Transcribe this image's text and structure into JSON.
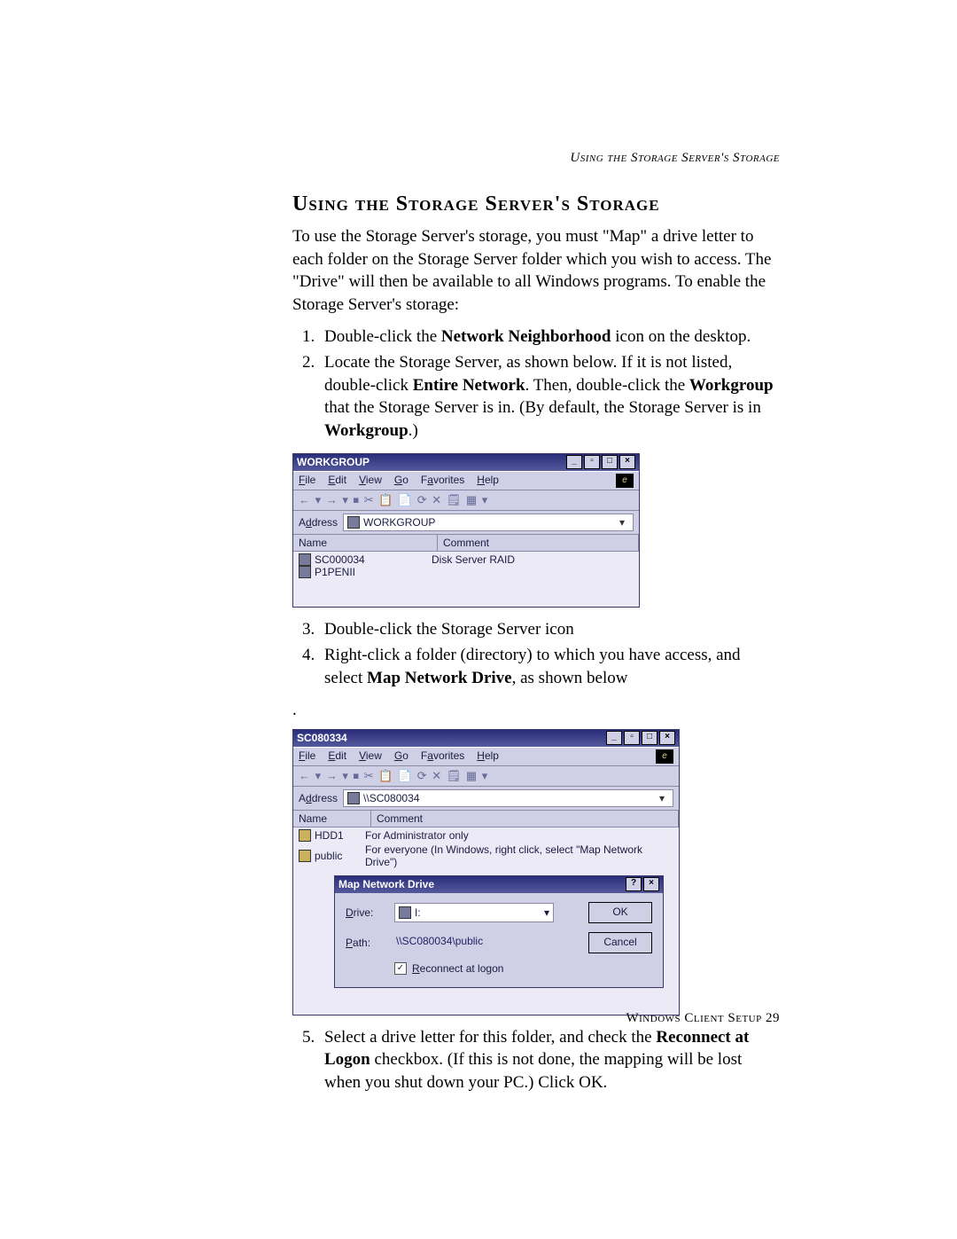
{
  "running_header": "Using the Storage Server's Storage",
  "title": "Using the Storage Server's Storage",
  "intro": "To use the Storage Server's storage, you must \"Map\" a drive letter to each folder on the Storage Server folder which you wish to access. The \"Drive\" will then be available to all Windows programs. To enable the Storage Server's storage:",
  "step1_a": "Double-click the ",
  "step1_b": "Network Neighborhood",
  "step1_c": " icon on the desktop.",
  "step2_a": "Locate the Storage Server, as shown below. If it is not listed, double-click ",
  "step2_b": "Entire Network",
  "step2_c": ". Then, double-click the ",
  "step2_d": "Workgroup",
  "step2_e": " that the Storage Server is in. (By default, the Storage Server is in ",
  "step2_f": "Workgroup",
  "step2_g": ".)",
  "win1": {
    "title": "WORKGROUP",
    "menu": {
      "file": "File",
      "edit": "Edit",
      "view": "View",
      "go": "Go",
      "fav": "Favorites",
      "help": "Help"
    },
    "toolbar_glyphs": "← ▾ → ▾ ⏹  ✂ 📋 📄 ⟳  ✕ 🗒  ▦ ▾",
    "addr_label": "Address",
    "addr_value": "WORKGROUP",
    "col_name": "Name",
    "col_comment": "Comment",
    "rows": [
      {
        "name": "SC000034",
        "comment": "Disk Server RAID"
      },
      {
        "name": "P1PENII",
        "comment": ""
      }
    ]
  },
  "step3": "Double-click the Storage Server icon",
  "step4_a": "Right-click a folder (directory) to which you have access, and select ",
  "step4_b": "Map Network Drive",
  "step4_c": ", as shown below",
  "win2": {
    "title": "SC080334",
    "menu": {
      "file": "File",
      "edit": "Edit",
      "view": "View",
      "go": "Go",
      "fav": "Favorites",
      "help": "Help"
    },
    "toolbar_glyphs": "← ▾ → ▾ ⏹  ✂ 📋 📄 ⟳  ✕ 🗒  ▦ ▾",
    "addr_label": "Address",
    "addr_value": "\\\\SC080034",
    "col_name": "Name",
    "col_comment": "Comment",
    "rows": [
      {
        "name": "HDD1",
        "comment": "For Administrator only"
      },
      {
        "name": "public",
        "comment": "For everyone (In Windows, right click, select \"Map Network Drive\")"
      }
    ],
    "dialog": {
      "title": "Map Network Drive",
      "drive_label": "Drive:",
      "drive_value": "I:",
      "path_label": "Path:",
      "path_value": "\\\\SC080034\\public",
      "ok": "OK",
      "cancel": "Cancel",
      "reconnect": "Reconnect at logon"
    }
  },
  "step5_a": "Select a drive letter for this folder, and check the ",
  "step5_b": "Reconnect at Logon",
  "step5_c": " checkbox. (If this is not done, the mapping will be lost when you shut down your PC.) Click OK.",
  "footer_a": "Windows Client Setup ",
  "footer_b": "29"
}
